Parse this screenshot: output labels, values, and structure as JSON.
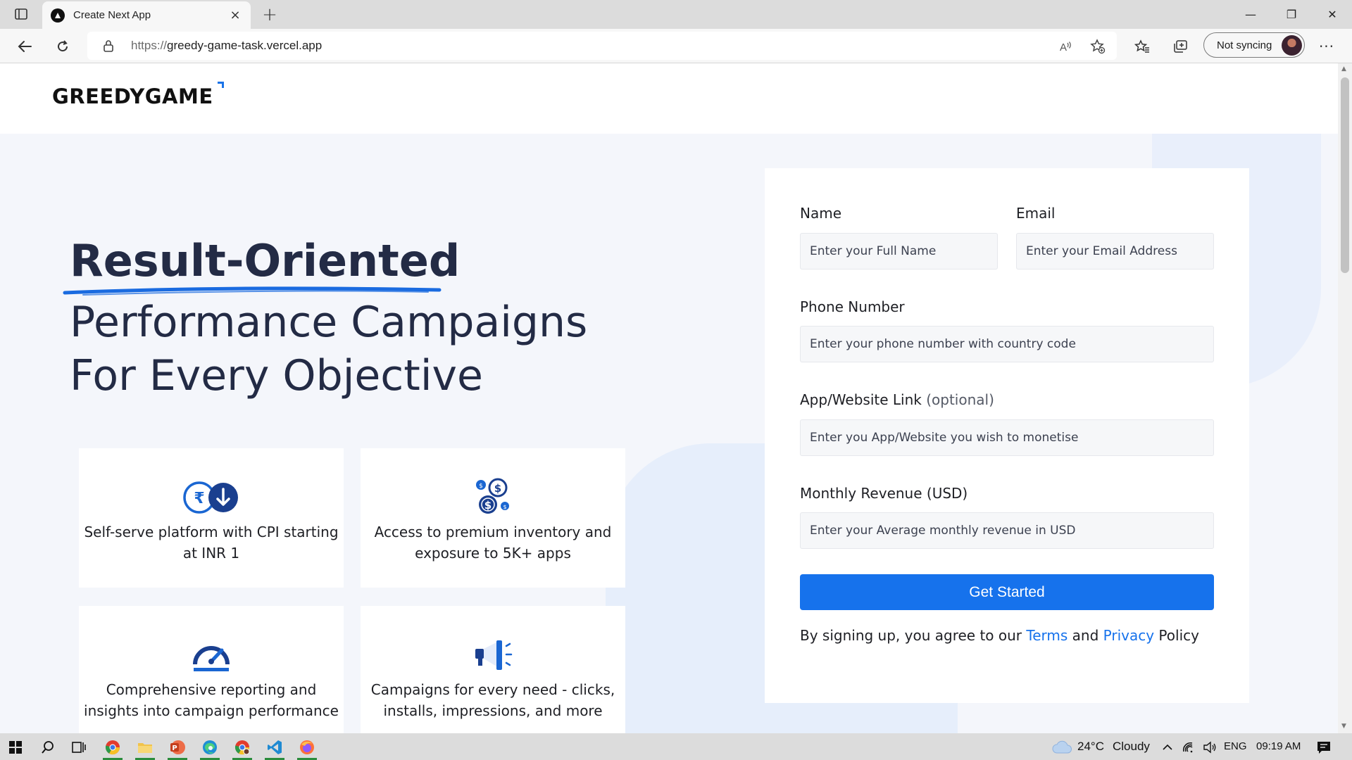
{
  "browser": {
    "tab_title": "Create Next App",
    "tab_close": "×",
    "new_tab": "+",
    "url_protocol": "https://",
    "url_host": "greedy-game-task.vercel.app",
    "sync_label": "Not syncing",
    "more_label": "···",
    "win_minimize": "—",
    "win_restore": "❐",
    "win_close": "✕"
  },
  "site": {
    "logo": "GREEDYGAME",
    "headline_highlight": "Result-Oriented",
    "headline_line2": "Performance Campaigns",
    "headline_line3": "For Every Objective"
  },
  "features": [
    {
      "icon": "rupee-download-icon",
      "text": "Self-serve platform with CPI starting at INR 1"
    },
    {
      "icon": "dollar-coins-icon",
      "text": "Access to premium inventory and exposure to 5K+ apps"
    },
    {
      "icon": "speedometer-icon",
      "text": "Comprehensive reporting and insights into campaign performance"
    },
    {
      "icon": "megaphone-icon",
      "text": "Campaigns for every need - clicks, installs, impressions, and more"
    }
  ],
  "form": {
    "name_label": "Name",
    "name_placeholder": "Enter your Full Name",
    "email_label": "Email",
    "email_placeholder": "Enter your Email Address",
    "phone_label": "Phone Number",
    "phone_placeholder": "Enter your phone number with country code",
    "app_label": "App/Website Link",
    "app_label_optional": "(optional)",
    "app_placeholder": "Enter you App/Website you wish to monetise",
    "revenue_label": "Monthly Revenue (USD)",
    "revenue_placeholder": "Enter your Average monthly revenue in USD",
    "submit_label": "Get Started",
    "terms_prefix": "By signing up, you agree to our",
    "terms_link": "Terms",
    "terms_and": "and",
    "privacy_link": "Privacy",
    "terms_suffix": "Policy"
  },
  "taskbar": {
    "temperature": "24°C",
    "weather": "Cloudy",
    "language": "ENG",
    "time": "09:19 AM"
  },
  "colors": {
    "accent": "#1672ec",
    "heading": "#232b45",
    "hero_bg": "#f4f6fb"
  }
}
